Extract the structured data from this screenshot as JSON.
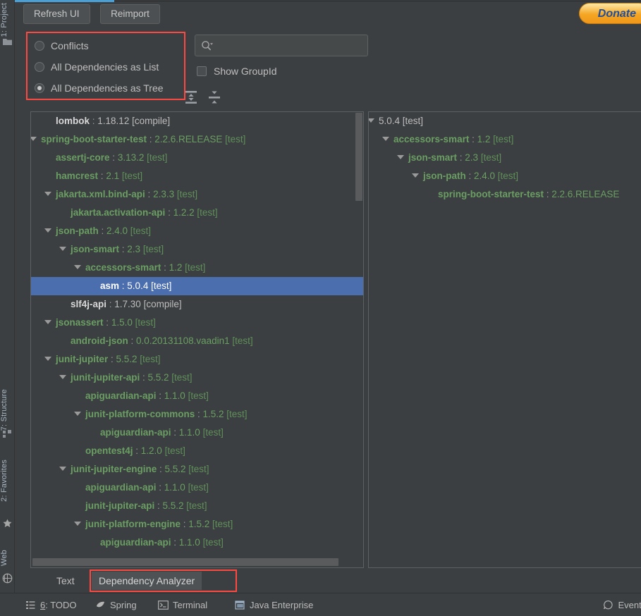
{
  "window": {
    "donate_label": "Donate"
  },
  "sidebar": {
    "tabs": [
      {
        "label": "1: Project",
        "icon": "project-folder-icon"
      },
      {
        "label": "7: Structure",
        "icon": "structure-icon"
      },
      {
        "label": "2: Favorites",
        "icon": "star-icon"
      },
      {
        "label": "Web",
        "icon": "web-globe-icon"
      }
    ]
  },
  "toolbar": {
    "refresh_label": "Refresh UI",
    "reimport_label": "Reimport",
    "expand_all_title": "Expand All",
    "collapse_all_title": "Collapse All"
  },
  "view_options": {
    "radios": [
      {
        "label": "Conflicts",
        "selected": false
      },
      {
        "label": "All Dependencies as List",
        "selected": false
      },
      {
        "label": "All Dependencies as Tree",
        "selected": true
      }
    ]
  },
  "search": {
    "value": "",
    "placeholder": "",
    "icon": "search-icon"
  },
  "show_groupid": {
    "label": "Show GroupId",
    "checked": false
  },
  "left_tree": {
    "rows": [
      {
        "indent": 1,
        "arrow": false,
        "artifact": "lombok",
        "version": "1.18.12",
        "scope": "[compile]",
        "selected": false,
        "white": true
      },
      {
        "indent": 0,
        "arrow": true,
        "artifact": "spring-boot-starter-test",
        "version": "2.2.6.RELEASE",
        "scope": "[test]",
        "selected": false,
        "white": false
      },
      {
        "indent": 1,
        "arrow": false,
        "artifact": "assertj-core",
        "version": "3.13.2",
        "scope": "[test]",
        "selected": false,
        "white": false
      },
      {
        "indent": 1,
        "arrow": false,
        "artifact": "hamcrest",
        "version": "2.1",
        "scope": "[test]",
        "selected": false,
        "white": false
      },
      {
        "indent": 1,
        "arrow": true,
        "artifact": "jakarta.xml.bind-api",
        "version": "2.3.3",
        "scope": "[test]",
        "selected": false,
        "white": false
      },
      {
        "indent": 2,
        "arrow": false,
        "artifact": "jakarta.activation-api",
        "version": "1.2.2",
        "scope": "[test]",
        "selected": false,
        "white": false
      },
      {
        "indent": 1,
        "arrow": true,
        "artifact": "json-path",
        "version": "2.4.0",
        "scope": "[test]",
        "selected": false,
        "white": false
      },
      {
        "indent": 2,
        "arrow": true,
        "artifact": "json-smart",
        "version": "2.3",
        "scope": "[test]",
        "selected": false,
        "white": false
      },
      {
        "indent": 3,
        "arrow": true,
        "artifact": "accessors-smart",
        "version": "1.2",
        "scope": "[test]",
        "selected": false,
        "white": false
      },
      {
        "indent": 4,
        "arrow": false,
        "artifact": "asm",
        "version": "5.0.4",
        "scope": "[test]",
        "selected": true,
        "white": false
      },
      {
        "indent": 2,
        "arrow": false,
        "artifact": "slf4j-api",
        "version": "1.7.30",
        "scope": "[compile]",
        "selected": false,
        "white": true
      },
      {
        "indent": 1,
        "arrow": true,
        "artifact": "jsonassert",
        "version": "1.5.0",
        "scope": "[test]",
        "selected": false,
        "white": false
      },
      {
        "indent": 2,
        "arrow": false,
        "artifact": "android-json",
        "version": "0.0.20131108.vaadin1",
        "scope": "[test]",
        "selected": false,
        "white": false
      },
      {
        "indent": 1,
        "arrow": true,
        "artifact": "junit-jupiter",
        "version": "5.5.2",
        "scope": "[test]",
        "selected": false,
        "white": false
      },
      {
        "indent": 2,
        "arrow": true,
        "artifact": "junit-jupiter-api",
        "version": "5.5.2",
        "scope": "[test]",
        "selected": false,
        "white": false
      },
      {
        "indent": 3,
        "arrow": false,
        "artifact": "apiguardian-api",
        "version": "1.1.0",
        "scope": "[test]",
        "selected": false,
        "white": false
      },
      {
        "indent": 3,
        "arrow": true,
        "artifact": "junit-platform-commons",
        "version": "1.5.2",
        "scope": "[test]",
        "selected": false,
        "white": false
      },
      {
        "indent": 4,
        "arrow": false,
        "artifact": "apiguardian-api",
        "version": "1.1.0",
        "scope": "[test]",
        "selected": false,
        "white": false
      },
      {
        "indent": 3,
        "arrow": false,
        "artifact": "opentest4j",
        "version": "1.2.0",
        "scope": "[test]",
        "selected": false,
        "white": false
      },
      {
        "indent": 2,
        "arrow": true,
        "artifact": "junit-jupiter-engine",
        "version": "5.5.2",
        "scope": "[test]",
        "selected": false,
        "white": false
      },
      {
        "indent": 3,
        "arrow": false,
        "artifact": "apiguardian-api",
        "version": "1.1.0",
        "scope": "[test]",
        "selected": false,
        "white": false
      },
      {
        "indent": 3,
        "arrow": false,
        "artifact": "junit-jupiter-api",
        "version": "5.5.2",
        "scope": "[test]",
        "selected": false,
        "white": false
      },
      {
        "indent": 3,
        "arrow": true,
        "artifact": "junit-platform-engine",
        "version": "1.5.2",
        "scope": "[test]",
        "selected": false,
        "white": false
      },
      {
        "indent": 4,
        "arrow": false,
        "artifact": "apiguardian-api",
        "version": "1.1.0",
        "scope": "[test]",
        "selected": false,
        "white": false
      }
    ]
  },
  "right_tree": {
    "rows": [
      {
        "indent": 0,
        "arrow": true,
        "artifact": "",
        "version": "5.0.4",
        "scope": "[test]",
        "white": true
      },
      {
        "indent": 1,
        "arrow": true,
        "artifact": "accessors-smart",
        "version": "1.2",
        "scope": "[test]",
        "white": false
      },
      {
        "indent": 2,
        "arrow": true,
        "artifact": "json-smart",
        "version": "2.3",
        "scope": "[test]",
        "white": false
      },
      {
        "indent": 3,
        "arrow": true,
        "artifact": "json-path",
        "version": "2.4.0",
        "scope": "[test]",
        "white": false
      },
      {
        "indent": 4,
        "arrow": false,
        "artifact": "spring-boot-starter-test",
        "version": "2.2.6.RELEASE",
        "scope": "",
        "white": false
      }
    ]
  },
  "bottom_tabs": [
    {
      "label": "Text",
      "active": false
    },
    {
      "label": "Dependency Analyzer",
      "active": true
    }
  ],
  "status_bar": {
    "items": [
      {
        "label": "6: TODO",
        "icon": "todo-list-icon",
        "underline_first": true
      },
      {
        "label": "Spring",
        "icon": "spring-leaf-icon",
        "underline_first": false
      },
      {
        "label": "Terminal",
        "icon": "terminal-icon",
        "underline_first": false
      },
      {
        "label": "Java Enterprise",
        "icon": "java-enterprise-icon",
        "underline_first": false
      }
    ],
    "event_log_label": "Event Log",
    "event_log_icon": "event-log-icon"
  },
  "colors": {
    "accent_cyan": "#4a9fd4",
    "selection_blue": "#4b6eaf",
    "annotation_red": "#fc4a42",
    "artifact_green": "#6a9e63",
    "donate_orange": "#f5a623"
  }
}
